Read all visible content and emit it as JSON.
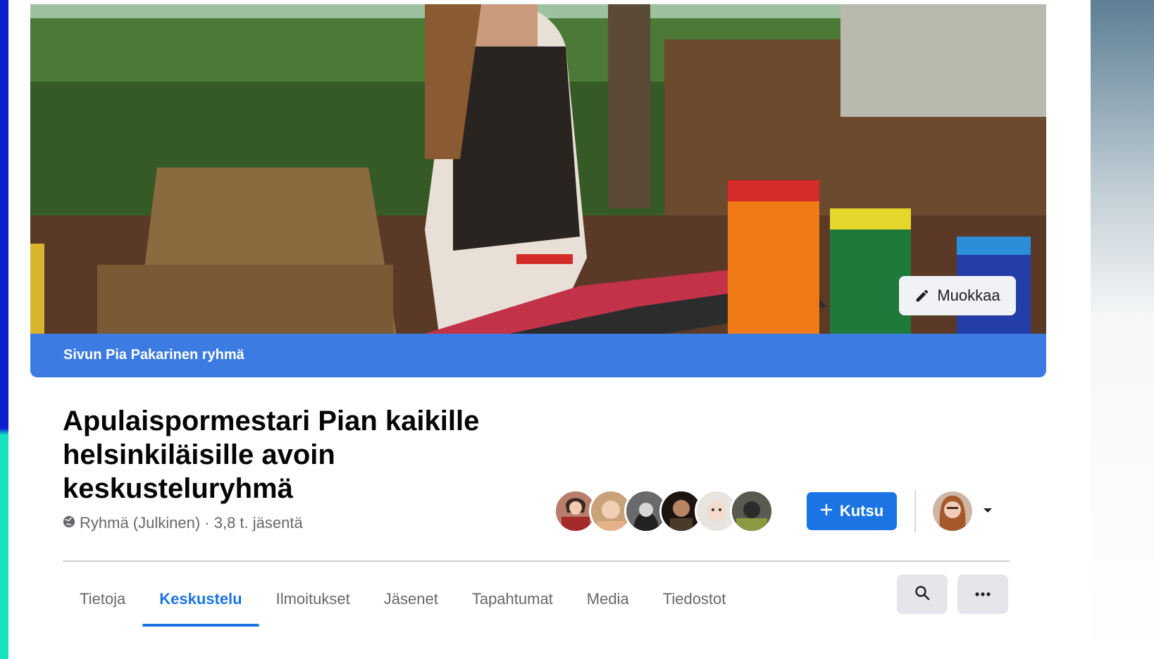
{
  "cover": {
    "edit_label": "Muokkaa"
  },
  "owner_bar": {
    "text": "Sivun Pia Pakarinen ryhmä"
  },
  "group": {
    "title": "Apulaispormestari Pian kaikille helsinkiläisille avoin keskusteluryhmä",
    "meta": "Ryhmä (Julkinen) · 3,8 t. jäsentä"
  },
  "actions": {
    "invite_label": "Kutsu"
  },
  "tabs": [
    {
      "label": "Tietoja"
    },
    {
      "label": "Keskustelu"
    },
    {
      "label": "Ilmoitukset"
    },
    {
      "label": "Jäsenet"
    },
    {
      "label": "Tapahtumat"
    },
    {
      "label": "Media"
    },
    {
      "label": "Tiedostot"
    }
  ],
  "colors": {
    "accent": "#1b74e4",
    "owner_bar": "#3b7be2"
  }
}
